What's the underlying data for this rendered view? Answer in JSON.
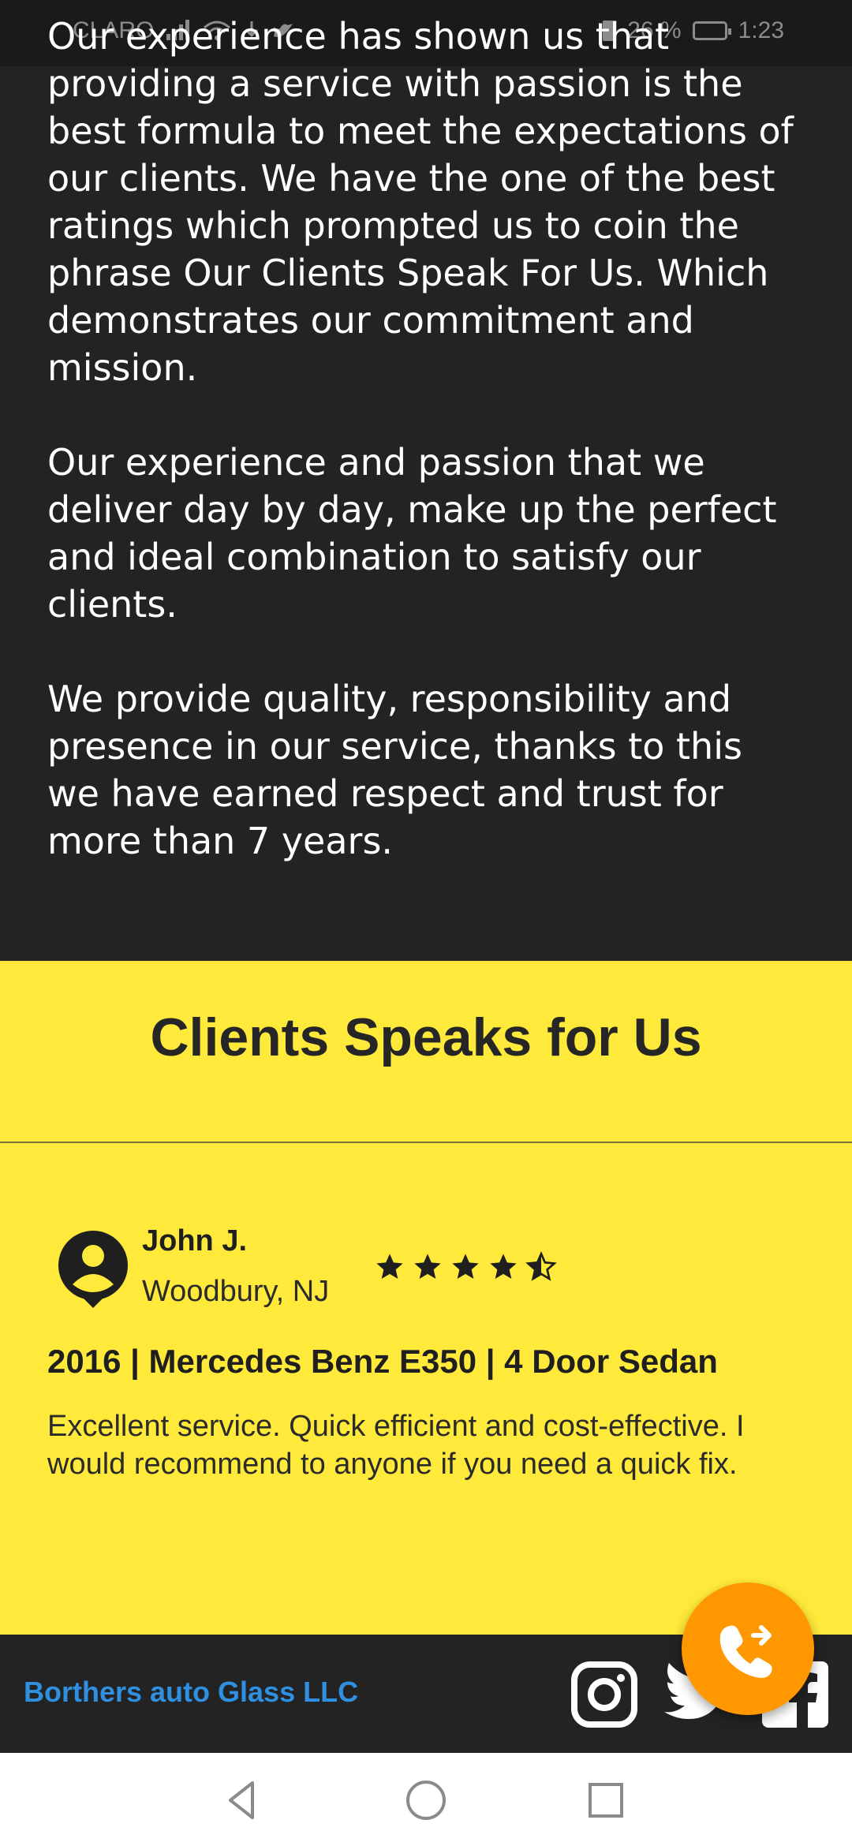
{
  "status_bar": {
    "carrier": "CLARO",
    "battery_percent": "26 %",
    "time": "1:23"
  },
  "intro": {
    "paragraph1": "Our experience has shown us that providing a service with passion is the best formula to meet the expectations of our clients. We have the one of the best ratings which prompted us to coin the phrase Our Clients Speak For Us. Which demonstrates our commitment and mission.",
    "paragraph2": "Our experience and passion that we deliver day by day, make up the perfect and ideal combination to satisfy our clients.",
    "paragraph3": "We provide quality, responsibility and presence in our service, thanks to this we have earned respect and trust for more than 7 years."
  },
  "testimonials": {
    "title": "Clients Speaks for Us",
    "review": {
      "name": "John J.",
      "location": "Woodbury, NJ",
      "rating": 4.5,
      "vehicle": "2016 | Mercedes Benz E350 | 4 Door Sedan",
      "text": "Excellent service. Quick efficient and cost-effective. I would recommend to anyone if you need a quick fix."
    }
  },
  "footer": {
    "brand": "Borthers auto Glass LLC",
    "icons": [
      "instagram-icon",
      "twitter-icon",
      "facebook-icon"
    ]
  },
  "fab": {
    "icon": "phone-forward-icon",
    "color": "#ff9800"
  },
  "colors": {
    "dark_bg": "#232323",
    "yellow_bg": "#ffea3b",
    "brand_blue": "#2f8fe0"
  },
  "nav": {
    "icons": [
      "back-icon",
      "home-icon",
      "recents-icon"
    ]
  }
}
